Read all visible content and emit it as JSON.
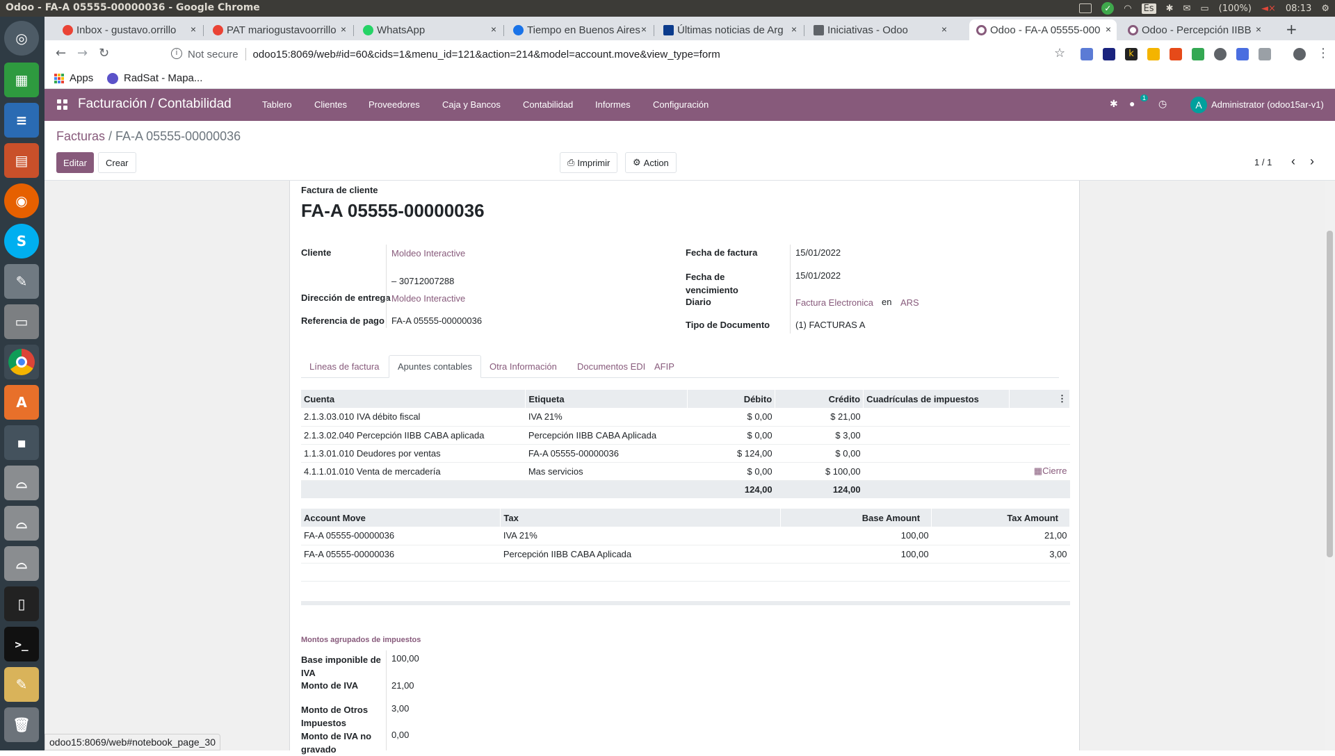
{
  "os": {
    "window_title": "Odoo - FA-A 05555-00000036 - Google Chrome",
    "battery": "(100%)",
    "clock": "08:13",
    "keyboard": "Es"
  },
  "browser": {
    "tabs": [
      {
        "label": "Inbox - gustavo.orrillo",
        "color": "#ea4335"
      },
      {
        "label": "PAT mariogustavoorrillo",
        "color": "#ea4335"
      },
      {
        "label": "WhatsApp",
        "color": "#25d366"
      },
      {
        "label": "Tiempo en Buenos Aires",
        "color": "#1a73e8"
      },
      {
        "label": "Últimas noticias de Arg",
        "color": "#0b3b8c"
      },
      {
        "label": "Iniciativas - Odoo",
        "color": "#5f6368"
      },
      {
        "label": "Odoo - FA-A 05555-000",
        "color": "#875a7b"
      },
      {
        "label": "Odoo - Percepción IIBB",
        "color": "#875a7b"
      }
    ],
    "not_secure": "Not secure",
    "url": "odoo15:8069/web#id=60&cids=1&menu_id=121&action=214&model=account.move&view_type=form",
    "bookmarks": [
      "Apps",
      "RadSat - Mapa..."
    ]
  },
  "odoo_nav": {
    "brand": "Facturación / Contabilidad",
    "menus": [
      "Tablero",
      "Clientes",
      "Proveedores",
      "Caja y Bancos",
      "Contabilidad",
      "Informes",
      "Configuración"
    ],
    "chat_count": "1",
    "avatar_letter": "A",
    "user": "Administrator (odoo15ar-v1)"
  },
  "control": {
    "breadcrumb_parent": "Facturas",
    "breadcrumb_sep": " / ",
    "breadcrumb_current": "FA-A 05555-00000036",
    "edit": "Editar",
    "create": "Crear",
    "print": "Imprimir",
    "action": "Action",
    "pager": "1 / 1"
  },
  "invoice": {
    "type": "Factura de cliente",
    "number": "FA-A 05555-00000036",
    "left_fields": [
      {
        "label": "Cliente",
        "value": "Moldeo Interactive"
      },
      {
        "label": "",
        "value": "– 30712007288"
      },
      {
        "label": "Dirección de entrega",
        "value": "Moldeo Interactive"
      },
      {
        "label": "Referencia de pago",
        "value": "FA-A 05555-00000036"
      }
    ],
    "right_fields": {
      "fecha_factura_label": "Fecha de factura",
      "fecha_factura": "15/01/2022",
      "vencimiento_label": "Fecha de vencimiento",
      "vencimiento": "15/01/2022",
      "diario_label": "Diario",
      "diario": "Factura Electronica",
      "en": "en",
      "moneda": "ARS",
      "tipo_doc_label": "Tipo de Documento",
      "tipo_doc": "(1) FACTURAS A"
    }
  },
  "notebook": {
    "tabs": [
      "Líneas de factura",
      "Apuntes contables",
      "Otra Información",
      "Documentos EDI",
      "AFIP"
    ],
    "active": "Apuntes contables"
  },
  "apuntes": {
    "headers": [
      "Cuenta",
      "Etiqueta",
      "Débito",
      "Crédito",
      "Cuadrículas de impuestos"
    ],
    "rows": [
      {
        "cuenta": "2.1.3.03.010 IVA débito fiscal",
        "etiqueta": "IVA 21%",
        "debito": "$ 0,00",
        "credito": "$ 21,00",
        "extra": ""
      },
      {
        "cuenta": "2.1.3.02.040 Percepción IIBB CABA aplicada",
        "etiqueta": "Percepción IIBB CABA Aplicada",
        "debito": "$ 0,00",
        "credito": "$ 3,00",
        "extra": ""
      },
      {
        "cuenta": "1.1.3.01.010 Deudores por ventas",
        "etiqueta": "FA-A 05555-00000036",
        "debito": "$ 124,00",
        "credito": "$ 0,00",
        "extra": ""
      },
      {
        "cuenta": "4.1.1.01.010 Venta de mercadería",
        "etiqueta": "Mas servicios",
        "debito": "$ 0,00",
        "credito": "$ 100,00",
        "extra": "Cierre"
      }
    ],
    "total_debito": "124,00",
    "total_credito": "124,00"
  },
  "taxes": {
    "headers": [
      "Account Move",
      "Tax",
      "Base Amount",
      "Tax Amount"
    ],
    "rows": [
      {
        "move": "FA-A 05555-00000036",
        "tax": "IVA 21%",
        "base": "100,00",
        "amount": "21,00"
      },
      {
        "move": "FA-A 05555-00000036",
        "tax": "Percepción IIBB CABA Aplicada",
        "base": "100,00",
        "amount": "3,00"
      }
    ]
  },
  "montos": {
    "title": "Montos agrupados de impuestos",
    "items": [
      {
        "label": "Base imponible de IVA",
        "value": "100,00"
      },
      {
        "label": "Monto de IVA",
        "value": "21,00"
      },
      {
        "label": "Monto de Otros Impuestos",
        "value": "3,00"
      },
      {
        "label": "Monto de IVA no gravado",
        "value": "0,00"
      }
    ]
  },
  "status_url": "odoo15:8069/web#notebook_page_30"
}
